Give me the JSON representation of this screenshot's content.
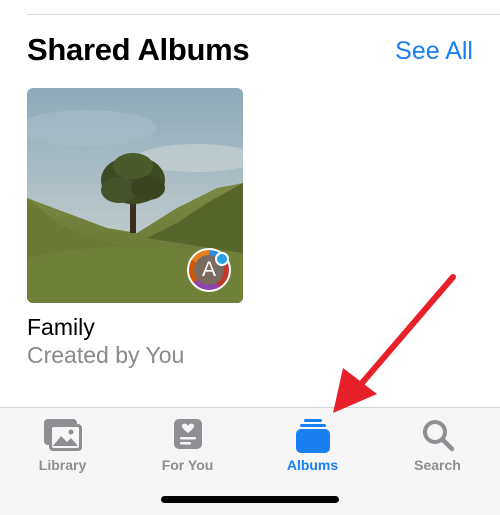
{
  "section": {
    "title": "Shared Albums",
    "see_all": "See All"
  },
  "album": {
    "name": "Family",
    "subtitle": "Created by You",
    "avatar_letter": "A"
  },
  "tabs": [
    {
      "label": "Library",
      "icon": "photos-library-icon",
      "active": false
    },
    {
      "label": "For You",
      "icon": "for-you-icon",
      "active": false
    },
    {
      "label": "Albums",
      "icon": "albums-icon",
      "active": true
    },
    {
      "label": "Search",
      "icon": "search-icon",
      "active": false
    }
  ],
  "colors": {
    "accent": "#1a7ff0",
    "inactive": "#8e8e93",
    "annotation_arrow": "#e8202a"
  }
}
